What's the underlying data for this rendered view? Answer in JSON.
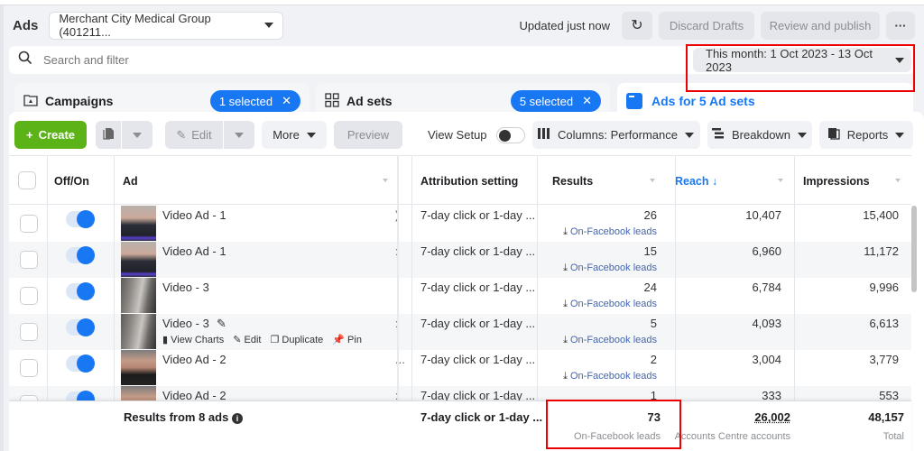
{
  "header": {
    "title": "Ads",
    "account": "Merchant City Medical Group (401211...",
    "updated": "Updated just now",
    "refresh_icon": "↻",
    "discard": "Discard Drafts",
    "review": "Review and publish",
    "more": "···"
  },
  "search": {
    "placeholder": "Search and filter",
    "date_range": "This month: 1 Oct 2023 - 13 Oct 2023"
  },
  "tabs": [
    {
      "label": "Campaigns",
      "icon": "folder-icon",
      "badge": "1 selected"
    },
    {
      "label": "Ad sets",
      "icon": "grid-icon",
      "badge": "5 selected"
    },
    {
      "label": "Ads for 5 Ad sets",
      "icon": "ad-icon",
      "active": true
    }
  ],
  "toolbar": {
    "create": "Create",
    "edit": "Edit",
    "more": "More",
    "preview": "Preview",
    "view_setup": "View Setup",
    "columns": "Columns: Performance",
    "breakdown": "Breakdown",
    "reports": "Reports"
  },
  "table": {
    "headers": {
      "toggle": "Off/On",
      "ad": "Ad",
      "attribution": "Attribution setting",
      "results": "Results",
      "reach": "Reach ↓",
      "impressions": "Impressions"
    },
    "rows": [
      {
        "name": "Video Ad - 1",
        "attribution": "7-day click or 1-day ...",
        "results": "26",
        "result_type": "On-Facebook leads",
        "reach": "10,407",
        "impressions": "15,400",
        "on": true,
        "trunc": ")"
      },
      {
        "name": "Video Ad - 1",
        "attribution": "7-day click or 1-day ...",
        "results": "15",
        "result_type": "On-Facebook leads",
        "reach": "6,960",
        "impressions": "11,172",
        "on": true,
        "trunc": ":"
      },
      {
        "name": "Video - 3",
        "attribution": "7-day click or 1-day ...",
        "results": "24",
        "result_type": "On-Facebook leads",
        "reach": "6,784",
        "impressions": "9,996",
        "on": true,
        "trunc": ""
      },
      {
        "name": "Video - 3",
        "attribution": "7-day click or 1-day ...",
        "results": "5",
        "result_type": "On-Facebook leads",
        "reach": "4,093",
        "impressions": "6,613",
        "on": true,
        "trunc": ":",
        "hover": true
      },
      {
        "name": "Video Ad - 2",
        "attribution": "7-day click or 1-day ...",
        "results": "2",
        "result_type": "On-Facebook leads",
        "reach": "3,004",
        "impressions": "3,779",
        "on": true,
        "trunc": "..."
      },
      {
        "name": "Video Ad - 2",
        "attribution": "7-day click or 1-day ...",
        "results": "1",
        "result_type": "On-Facebook leads",
        "reach": "333",
        "impressions": "553",
        "on": true,
        "trunc": ":"
      }
    ],
    "row_actions": {
      "view_charts": "View Charts",
      "edit": "Edit",
      "duplicate": "Duplicate",
      "pin": "Pin"
    },
    "footer": {
      "label": "Results from 8 ads",
      "attribution": "7-day click or 1-day ...",
      "results": "73",
      "results_sub": "On-Facebook leads",
      "reach": "26,002",
      "reach_sub": "Accounts Centre accounts",
      "impressions": "48,157",
      "impressions_sub": "Total"
    }
  }
}
